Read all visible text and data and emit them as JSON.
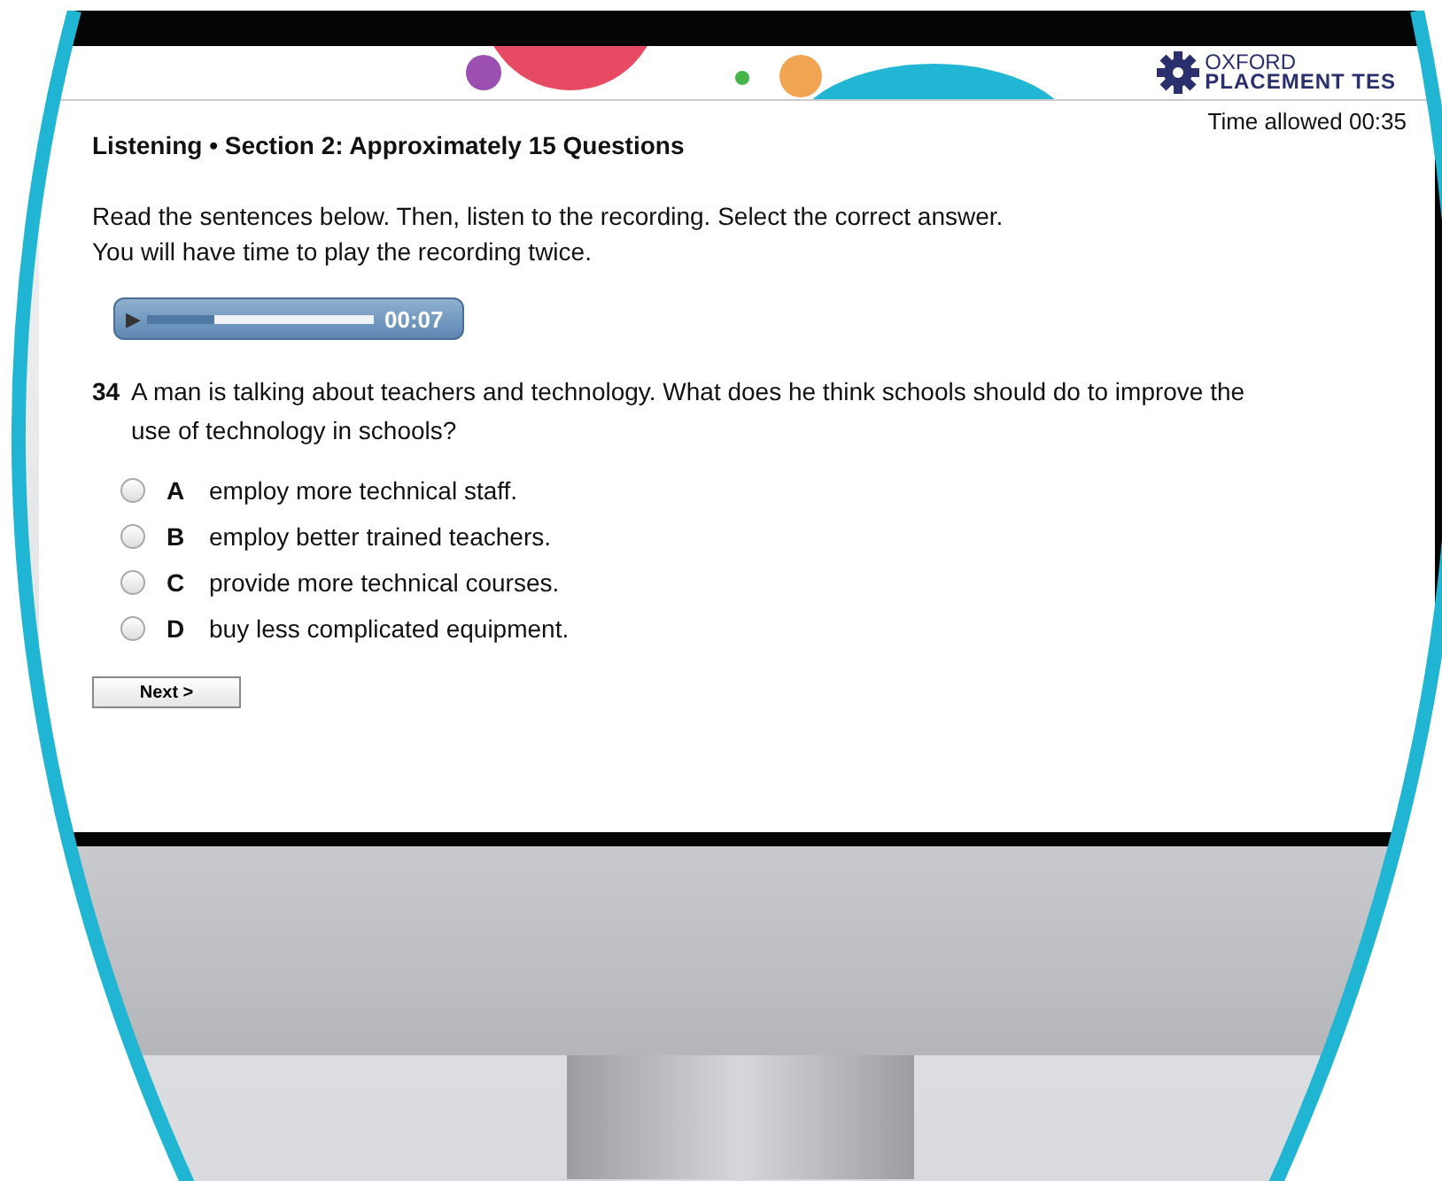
{
  "logo": {
    "line_1": "OXFORD",
    "line_2": "PLACEMENT TES"
  },
  "timer": "Time allowed 00:35",
  "section_title": "Listening • Section 2: Approximately 15 Questions",
  "instructions": [
    "Read the sentences below. Then, listen to the recording. Select the correct answer.",
    "You will have time to play the recording twice."
  ],
  "audio_player": {
    "play_icon": "▶",
    "level": 0.3,
    "time": "00:07"
  },
  "question": {
    "number": "34",
    "text": "A man is talking about teachers and technology. What does he think schools should do to improve the use of technology in schools?",
    "options": [
      {
        "letter": "A",
        "text": "employ more technical staff.",
        "selected": false
      },
      {
        "letter": "B",
        "text": "employ better trained teachers.",
        "selected": false
      },
      {
        "letter": "C",
        "text": "provide more technical courses.",
        "selected": false
      },
      {
        "letter": "D",
        "text": "buy less complicated equipment.",
        "selected": false
      }
    ]
  },
  "next_button": "Next >"
}
